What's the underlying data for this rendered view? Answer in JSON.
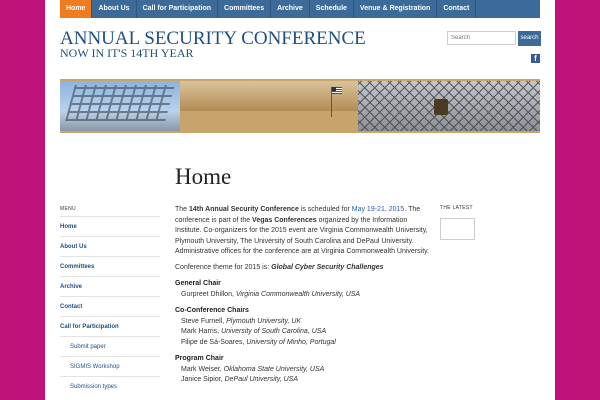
{
  "nav": {
    "items": [
      "Home",
      "About Us",
      "Call for Participation",
      "Committees",
      "Archive",
      "Schedule",
      "Venue & Registration",
      "Contact"
    ]
  },
  "header": {
    "title": "ANNUAL SECURITY CONFERENCE",
    "subtitle": "NOW IN IT'S 14TH YEAR",
    "search_placeholder": "Search",
    "search_button": "search",
    "facebook_glyph": "f"
  },
  "page_title": "Home",
  "sidebar": {
    "heading": "MENU",
    "items": [
      "Home",
      "About Us",
      "Committees",
      "Archive",
      "Contact",
      "Call for Participation"
    ],
    "subitems": [
      "Submit paper",
      "SIGMIS Workshop",
      "Submission types"
    ]
  },
  "main": {
    "p1_a": "The ",
    "p1_b": "14th Annual Security Conference",
    "p1_c": " is scheduled for ",
    "p1_d": "May 19-21, 2015",
    "p1_e": ". The conference is part of the ",
    "p1_f": "Vegas Conferences",
    "p1_g": " organized by the Information Institute. Co-organizers for the 2015 event are Virginia Commonwealth University, Plymouth University, The University of South Carolina and DePaul University. Administrative offices for the conference are at Virginia Commonwealth University.",
    "theme_a": "Conference theme for 2015 is: ",
    "theme_b": "Global Cyber Security Challenges",
    "general_chair_heading": "General Chair",
    "general_chair": [
      {
        "name": "Gurpreet Dhillon, ",
        "org": "Virginia Commonwealth University, USA"
      }
    ],
    "co_chairs_heading": "Co-Conference Chairs",
    "co_chairs": [
      {
        "name": "Steve Furnell, ",
        "org": "Plymouth University, UK"
      },
      {
        "name": "Mark Harris, ",
        "org": "University of South Carolina, USA"
      },
      {
        "name": "Filipe de Sá-Soares, ",
        "org": "University of Minho, Portugal"
      }
    ],
    "program_chair_heading": "Program Chair",
    "program_chairs": [
      {
        "name": "Mark Weiser, ",
        "org": "Oklahoma State University, USA"
      },
      {
        "name": "Janice Sipior, ",
        "org": "DePaul University, USA"
      }
    ]
  },
  "widget": {
    "heading": "THE LATEST"
  },
  "colors": {
    "frame": "#c0137a",
    "nav": "#3c6b9a",
    "nav_active": "#f07c22",
    "title": "#1f4f82"
  },
  "icons": {
    "social": "facebook-icon"
  }
}
